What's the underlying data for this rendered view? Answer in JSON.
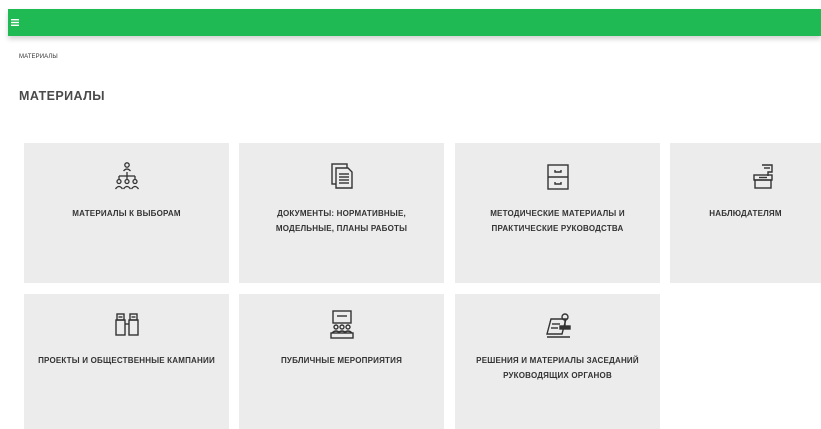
{
  "header": {
    "menu_icon": "hamburger-menu-icon",
    "color": "#1fba53"
  },
  "breadcrumb": "МАТЕРИАЛЫ",
  "page_title": "МАТЕРИАЛЫ",
  "tiles": [
    {
      "label": "МАТЕРИАЛЫ К ВЫБОРАМ",
      "icon": "hierarchy-people-icon"
    },
    {
      "label": "ДОКУМЕНТЫ: НОРМАТИВНЫЕ, МОДЕЛЬНЫЕ, ПЛАНЫ РАБОТЫ",
      "icon": "documents-icon"
    },
    {
      "label": "МЕТОДИЧЕСКИЕ МАТЕРИАЛЫ И ПРАКТИЧЕСКИЕ РУКОВОДСТВА",
      "icon": "filing-cabinet-icon"
    },
    {
      "label": "НАБЛЮДАТЕЛЯМ",
      "icon": "ballot-box-icon"
    },
    {
      "label": "ПРОЕКТЫ И ОБЩЕСТВЕННЫЕ КАМПАНИИ",
      "icon": "binoculars-icon"
    },
    {
      "label": "ПУБЛИЧНЫЕ МЕРОПРИЯТИЯ",
      "icon": "public-event-icon"
    },
    {
      "label": "РЕШЕНИЯ И МАТЕРИАЛЫ ЗАСЕДАНИЙ РУКОВОДЯЩИХ ОРГАНОВ",
      "icon": "stamp-document-icon"
    }
  ],
  "colors": {
    "tile_background": "#ececec",
    "text": "#333333"
  }
}
